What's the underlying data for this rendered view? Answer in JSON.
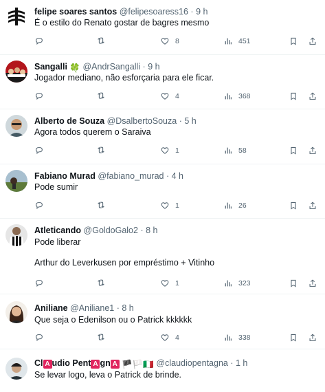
{
  "tweets": [
    {
      "name": "felipe soares santos",
      "handle": "@felipesoaress16",
      "time": "9 h",
      "text": "É o estilo do Renato gostar de bagres mesmo",
      "replies": "",
      "retweets": "",
      "likes": "8",
      "views": "451",
      "avatar_icon": "striped-crest-avatar"
    },
    {
      "name": "Sangalli",
      "name_emoji": "🍀",
      "handle": "@AndrSangalli",
      "time": "9 h",
      "text": "Jogador mediano, não esforçaria para ele ficar.",
      "replies": "",
      "retweets": "",
      "likes": "4",
      "views": "368",
      "avatar_icon": "red-crowd-avatar"
    },
    {
      "name": "Alberto de Souza",
      "handle": "@DsalbertoSouza",
      "time": "5 h",
      "text": "Agora todos querem o Saraiva",
      "replies": "",
      "retweets": "",
      "likes": "1",
      "views": "58",
      "avatar_icon": "man-sunglasses-avatar"
    },
    {
      "name": "Fabiano Murad",
      "handle": "@fabiano_murad",
      "time": "4 h",
      "text": "Pode sumir",
      "replies": "",
      "retweets": "",
      "likes": "1",
      "views": "26",
      "avatar_icon": "landscape-avatar"
    },
    {
      "name": "Atleticando",
      "handle": "@GoldoGalo2",
      "time": "8 h",
      "text": "Pode liberar\n\nArthur do Leverkusen por empréstimo + Vitinho",
      "replies": "",
      "retweets": "",
      "likes": "1",
      "views": "323",
      "avatar_icon": "striped-jersey-avatar"
    },
    {
      "name": "Aniliane",
      "handle": "@Aniliane1",
      "time": "8 h",
      "text": "Que seja o Edenilson ou o Patrick kkkkkk",
      "replies": "",
      "retweets": "",
      "likes": "4",
      "views": "338",
      "avatar_icon": "woman-portrait-avatar"
    },
    {
      "name_parts": [
        "Cl",
        "A",
        "udio Pent",
        "A",
        "gn",
        "A"
      ],
      "name_flags": "🏴🏳️🇮🇹",
      "handle": "@claudiopentagna",
      "time": "1 h",
      "text": "Se levar logo, leva o Patrick de brinde.",
      "avatar_icon": "man-helmet-avatar"
    }
  ],
  "separator": "·",
  "colors": {
    "text": "#0f1419",
    "secondary": "#536471",
    "divider": "#eff3f4",
    "badge_red": "#e0245e"
  },
  "action_icons": [
    "reply-icon",
    "retweet-icon",
    "like-icon",
    "views-icon",
    "bookmark-icon",
    "share-icon"
  ]
}
